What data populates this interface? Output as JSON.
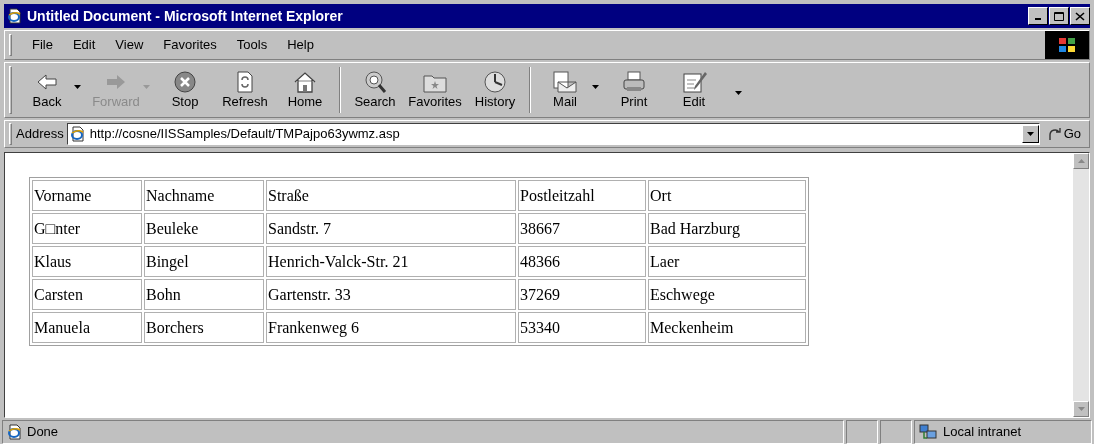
{
  "window": {
    "title": "Untitled Document - Microsoft Internet Explorer"
  },
  "menu": [
    {
      "label": "File"
    },
    {
      "label": "Edit"
    },
    {
      "label": "View"
    },
    {
      "label": "Favorites"
    },
    {
      "label": "Tools"
    },
    {
      "label": "Help"
    }
  ],
  "toolbar": [
    {
      "kind": "back",
      "label": "Back",
      "disabled": false,
      "dropdown": true
    },
    {
      "kind": "forward",
      "label": "Forward",
      "disabled": true,
      "dropdown": true
    },
    {
      "kind": "stop",
      "label": "Stop",
      "disabled": false,
      "dropdown": false
    },
    {
      "kind": "refresh",
      "label": "Refresh",
      "disabled": false,
      "dropdown": false
    },
    {
      "kind": "home",
      "label": "Home",
      "disabled": false,
      "dropdown": false
    },
    {
      "kind": "separator"
    },
    {
      "kind": "search",
      "label": "Search",
      "disabled": false,
      "dropdown": false
    },
    {
      "kind": "favorites",
      "label": "Favorites",
      "disabled": false,
      "dropdown": false
    },
    {
      "kind": "history",
      "label": "History",
      "disabled": false,
      "dropdown": false
    },
    {
      "kind": "separator"
    },
    {
      "kind": "mail",
      "label": "Mail",
      "disabled": false,
      "dropdown": true
    },
    {
      "kind": "print",
      "label": "Print",
      "disabled": false,
      "dropdown": false
    },
    {
      "kind": "edit",
      "label": "Edit",
      "disabled": false,
      "dropdown": false
    },
    {
      "kind": "more"
    }
  ],
  "address": {
    "label": "Address",
    "value": "http://cosne/IISSamples/Default/TMPajpo63ywmz.asp",
    "go": "Go"
  },
  "table": {
    "columns": [
      "Vorname",
      "Nachname",
      "Straße",
      "Postleitzahl",
      "Ort"
    ],
    "rows": [
      [
        "G□nter",
        "Beuleke",
        "Sandstr. 7",
        "38667",
        "Bad Harzburg"
      ],
      [
        "Klaus",
        "Bingel",
        "Henrich-Valck-Str. 21",
        "48366",
        "Laer"
      ],
      [
        "Carsten",
        "Bohn",
        "Gartenstr. 33",
        "37269",
        "Eschwege"
      ],
      [
        "Manuela",
        "Borchers",
        "Frankenweg 6",
        "53340",
        "Meckenheim"
      ]
    ]
  },
  "status_bar": {
    "text": "Done",
    "zone": "Local intranet"
  }
}
